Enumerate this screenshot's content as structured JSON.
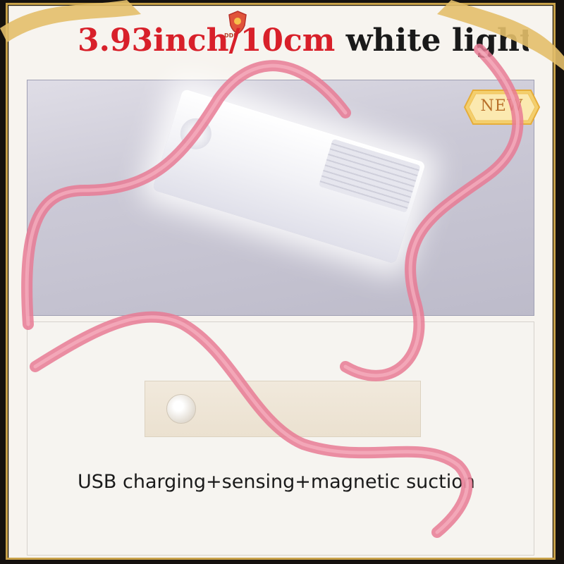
{
  "title": {
    "red_part": "3.93inch/10cm",
    "black_part": " white light"
  },
  "logo": {
    "text": "DDF"
  },
  "badge": {
    "label": "NEW"
  },
  "caption": "USB charging+sensing+magnetic suction",
  "colors": {
    "title_red": "#d8202a",
    "badge_gold": "#f0c35a",
    "ribbon_pink": "#e87a94",
    "frame_gold": "#c9a24a"
  }
}
